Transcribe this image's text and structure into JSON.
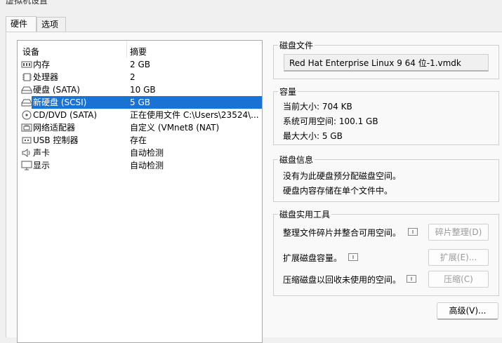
{
  "window": {
    "title": "虚拟机设置"
  },
  "tabs": [
    {
      "label": "硬件"
    },
    {
      "label": "选项"
    }
  ],
  "device_list": {
    "headers": {
      "device": "设备",
      "summary": "摘要"
    },
    "rows": [
      {
        "name": "内存",
        "summary": "2 GB",
        "icon": "memory-icon"
      },
      {
        "name": "处理器",
        "summary": "2",
        "icon": "cpu-icon"
      },
      {
        "name": "硬盘 (SATA)",
        "summary": "10 GB",
        "icon": "hard-disk-icon"
      },
      {
        "name": "新硬盘 (SCSI)",
        "summary": "5 GB",
        "icon": "hard-disk-icon",
        "selected": true
      },
      {
        "name": "CD/DVD (SATA)",
        "summary": "正在使用文件 C:\\Users\\23524\\...",
        "icon": "cd-dvd-icon"
      },
      {
        "name": "网络适配器",
        "summary": "自定义 (VMnet8 (NAT)",
        "icon": "network-icon"
      },
      {
        "name": "USB 控制器",
        "summary": "存在",
        "icon": "usb-icon"
      },
      {
        "name": "声卡",
        "summary": "自动检测",
        "icon": "speaker-icon"
      },
      {
        "name": "显示",
        "summary": "自动检测",
        "icon": "monitor-icon"
      }
    ]
  },
  "disk_file": {
    "legend": "磁盘文件",
    "value": "Red Hat Enterprise Linux 9 64 位-1.vmdk"
  },
  "capacity": {
    "legend": "容量",
    "current_size": "当前大小: 704 KB",
    "available": "系统可用空间: 100.1 GB",
    "max_size": "最大大小: 5 GB"
  },
  "disk_info": {
    "legend": "磁盘信息",
    "line1": "没有为此硬盘预分配磁盘空间。",
    "line2": "硬盘内容存储在单个文件中。"
  },
  "disk_tools": {
    "legend": "磁盘实用工具",
    "defrag_text": "整理文件碎片并整合可用空间。",
    "defrag_button": "碎片整理(D)",
    "expand_text": "扩展磁盘容量。",
    "expand_button": "扩展(E)...",
    "compact_text": "压缩磁盘以回收未使用的空间。",
    "compact_button": "压缩(C)"
  },
  "advanced_button": "高级(V)...",
  "colors": {
    "selection": "#1a73d3",
    "disabled_text": "#9a9a9a",
    "panel_bg": "#f9f9f9"
  }
}
